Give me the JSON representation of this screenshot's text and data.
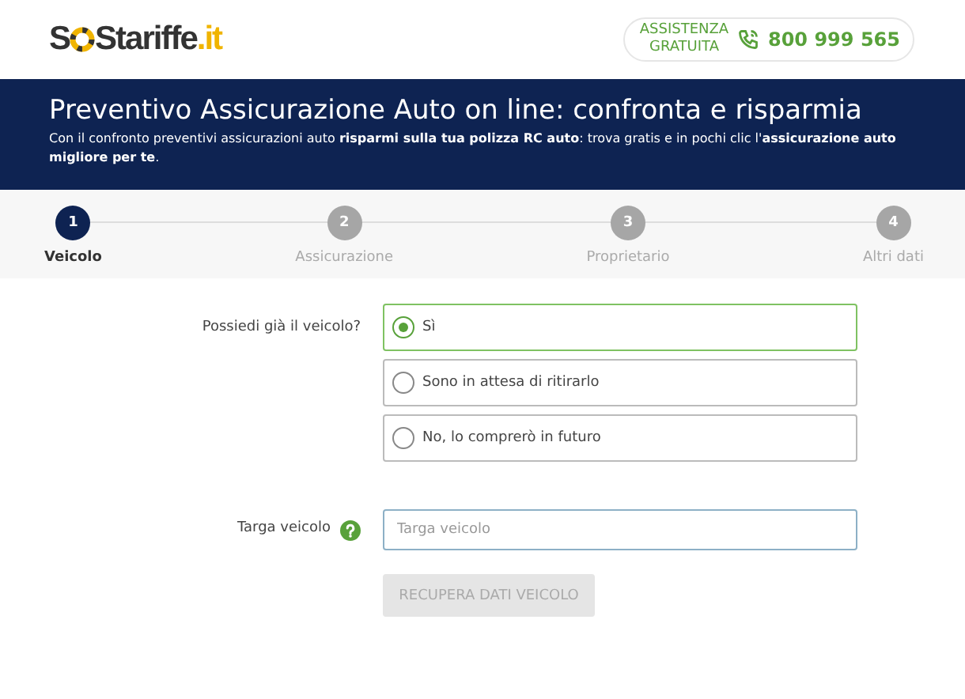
{
  "logo": {
    "prefix": "S",
    "main": "Stariffe",
    "suffix": ".it"
  },
  "assistance": {
    "label": "ASSISTENZA GRATUITA",
    "phone": "800 999 565"
  },
  "banner": {
    "title": "Preventivo Assicurazione Auto on line: confronta e risparmia",
    "subtitle": "Con il confronto preventivi assicurazioni auto **risparmi sulla tua polizza RC auto**: trova gratis e in pochi clic l'**assicurazione auto migliore per te**."
  },
  "steps": [
    {
      "number": "1",
      "label": "Veicolo",
      "selected": true
    },
    {
      "number": "2",
      "label": "Assicurazione",
      "selected": false
    },
    {
      "number": "3",
      "label": "Proprietario",
      "selected": false
    },
    {
      "number": "4",
      "label": "Altri dati",
      "selected": false
    }
  ],
  "question": {
    "label": "Possiedi già il veicolo?",
    "options": [
      {
        "label": "Sì",
        "selected": true
      },
      {
        "label": "Sono in attesa di ritirarlo",
        "selected": false
      },
      {
        "label": "No, lo comprerò in futuro",
        "selected": false
      }
    ]
  },
  "plate": {
    "label": "Targa veicolo",
    "placeholder": "Targa veicolo"
  },
  "button": {
    "label": "RECUPERA DATI VEICOLO",
    "disabled": true
  }
}
